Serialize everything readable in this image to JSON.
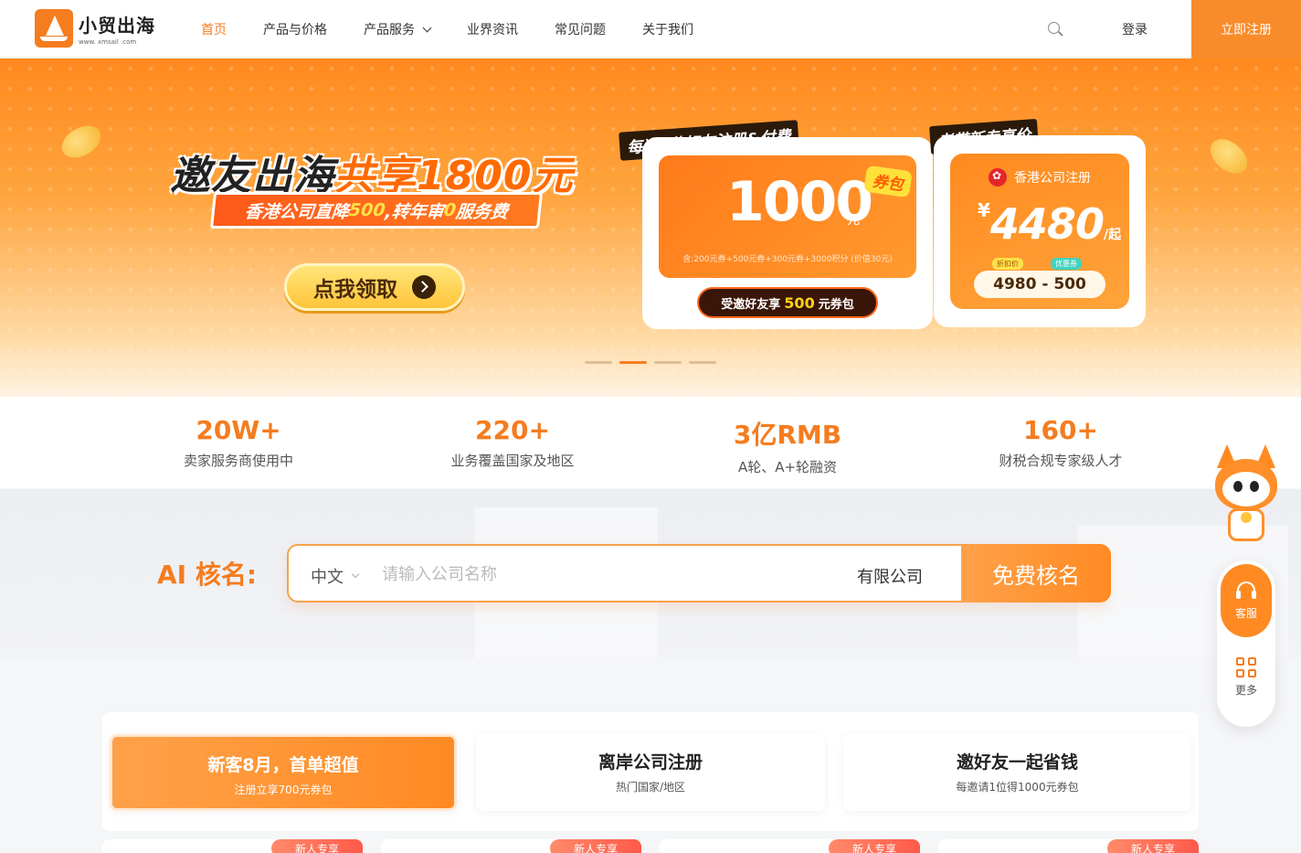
{
  "header": {
    "logo_title": "小贸出海",
    "logo_subtitle": "www. xmsail .com",
    "nav": [
      {
        "label": "首页",
        "active": true
      },
      {
        "label": "产品与价格"
      },
      {
        "label": "产品服务",
        "has_dropdown": true
      },
      {
        "label": "业界资讯"
      },
      {
        "label": "常见问题"
      },
      {
        "label": "关于我们"
      }
    ],
    "search_icon": "search-icon",
    "login_label": "登录",
    "register_label": "立即注册"
  },
  "banner": {
    "headline_part1": "邀友出海",
    "headline_part2": "共享1800元",
    "subline_part1": "香港公司直降",
    "subline_num1": "500",
    "subline_part2": ",转年审",
    "subline_num2": "0",
    "subline_part3": "服务费",
    "claim_label": "点我领取",
    "voucher_tag": "每邀1位好友注册&付费",
    "voucher_amount": "1000",
    "voucher_unit": "元",
    "voucher_badge": "券包",
    "voucher_note": "含:200元券+500元券+300元券+3000积分 (价值30元)",
    "voucher_btn_prefix": "受邀好友享",
    "voucher_btn_amount": "500",
    "voucher_btn_suffix": "元券包",
    "hk_tag": "老带新专享价",
    "hk_title": "香港公司注册",
    "hk_currency": "¥",
    "hk_price": "4480",
    "hk_per": "/起",
    "hk_tag1": "折扣价",
    "hk_tag2": "优惠券",
    "hk_calc": "4980 - 500",
    "active_slide": 2,
    "slide_count": 4
  },
  "stats": [
    {
      "value": "20W+",
      "label": "卖家服务商使用中"
    },
    {
      "value": "220+",
      "label": "业务覆盖国家及地区"
    },
    {
      "value": "3亿RMB",
      "label": "A轮、A+轮融资"
    },
    {
      "value": "160+",
      "label": "财税合规专家级人才"
    }
  ],
  "ai": {
    "label": "AI 核名:",
    "lang": "中文",
    "placeholder": "请输入公司名称",
    "suffix": "有限公司",
    "button": "免费核名"
  },
  "promos": [
    {
      "title": "新客8月，首单超值",
      "sub": "注册立享700元券包",
      "active": true
    },
    {
      "title": "离岸公司注册",
      "sub": "热门国家/地区"
    },
    {
      "title": "邀好友一起省钱",
      "sub": "每邀请1位得1000元券包"
    }
  ],
  "product_tags": [
    "新人专享",
    "新人专享",
    "新人专享",
    "新人专享"
  ],
  "side": {
    "service_label": "客服",
    "more_label": "更多"
  },
  "colors": {
    "accent": "#f57c1f",
    "accent_light": "#ffa14a"
  }
}
